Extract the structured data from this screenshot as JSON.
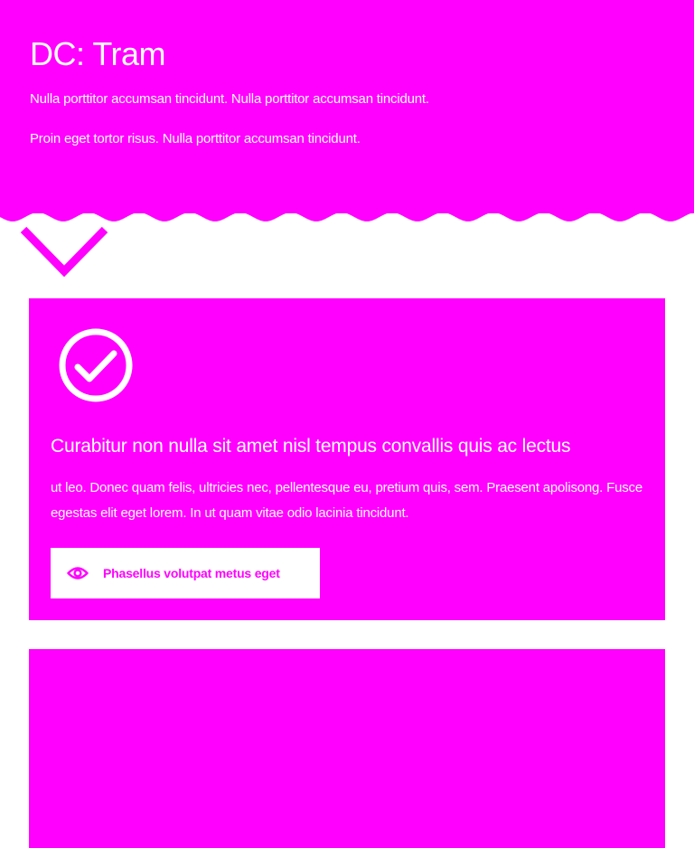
{
  "colors": {
    "accent": "#ff00ff",
    "text_on_accent": "#ffffff",
    "background": "#ffffff"
  },
  "hero": {
    "title": "DC: Tram",
    "paragraph_1": "Nulla porttitor accumsan tincidunt. Nulla porttitor accumsan tincidunt.",
    "paragraph_2": "Proin eget tortor risus. Nulla porttitor accumsan tincidunt."
  },
  "scroll_indicator": {
    "icon": "chevron-down-icon"
  },
  "cards": [
    {
      "icon": "check-circle-icon",
      "title": "Curabitur non nulla sit amet nisl tempus convallis quis ac lectus",
      "text": "ut leo. Donec quam felis, ultricies nec, pellentesque eu, pretium quis, sem. Praesent apolisong. Fusce egestas elit eget lorem. In ut quam vitae odio lacinia tincidunt.",
      "button": {
        "icon": "eye-icon",
        "label": "Phasellus volutpat metus eget"
      }
    }
  ]
}
